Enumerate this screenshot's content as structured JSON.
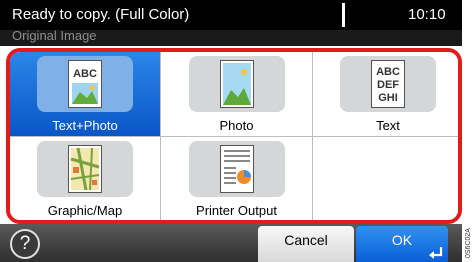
{
  "status_bar": {
    "message": "Ready to copy. (Full Color)",
    "time": "10:10"
  },
  "screen_title": "Original Image",
  "options": [
    {
      "label": "Text+Photo",
      "selected": true,
      "icon": "text-photo-icon"
    },
    {
      "label": "Photo",
      "selected": false,
      "icon": "photo-icon"
    },
    {
      "label": "Text",
      "selected": false,
      "icon": "text-icon"
    },
    {
      "label": "Graphic/Map",
      "selected": false,
      "icon": "graphic-map-icon"
    },
    {
      "label": "Printer Output",
      "selected": false,
      "icon": "printer-output-icon"
    }
  ],
  "icon_text": {
    "abc": "ABC",
    "text_lines": [
      "ABC",
      "DEF",
      "GHI"
    ]
  },
  "bottom_bar": {
    "help_label": "?",
    "cancel_label": "Cancel",
    "ok_label": "OK"
  },
  "side_code": "0S6C02A",
  "colors": {
    "selection_blue": "#0a56c8",
    "highlight_red": "#e21b1b",
    "ok_blue": "#0b5ed6"
  }
}
